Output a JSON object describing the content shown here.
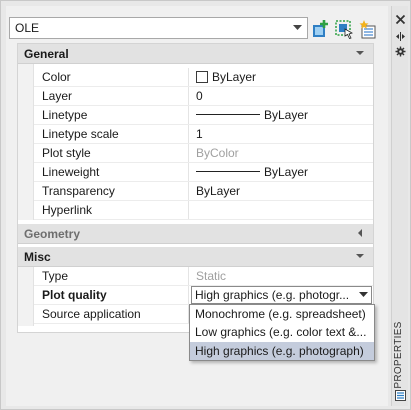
{
  "object_selector": {
    "value": "OLE"
  },
  "toolbar": [
    {
      "icon": "toggle-pickadd-icon",
      "tooltip": ""
    },
    {
      "icon": "select-objects-icon",
      "tooltip": ""
    },
    {
      "icon": "quick-select-icon",
      "tooltip": ""
    }
  ],
  "categories": {
    "general": {
      "label": "General",
      "rows": [
        {
          "name": "Color",
          "value": "ByLayer"
        },
        {
          "name": "Layer",
          "value": "0"
        },
        {
          "name": "Linetype",
          "value": "ByLayer"
        },
        {
          "name": "Linetype scale",
          "value": "1"
        },
        {
          "name": "Plot style",
          "value": "ByColor"
        },
        {
          "name": "Lineweight",
          "value": "ByLayer"
        },
        {
          "name": "Transparency",
          "value": "ByLayer"
        },
        {
          "name": "Hyperlink",
          "value": ""
        }
      ]
    },
    "geometry": {
      "label": "Geometry"
    },
    "misc": {
      "label": "Misc",
      "rows": [
        {
          "name": "Type",
          "value": "Static"
        },
        {
          "name": "Plot quality",
          "value": "High graphics (e.g. photogr..."
        },
        {
          "name": "Source application",
          "value": ""
        }
      ]
    }
  },
  "plot_quality_options": [
    "Monochrome (e.g. spreadsheet)",
    "Low graphics (e.g. color text &...",
    "High graphics (e.g. photograph)"
  ],
  "side_strip": {
    "label": "PROPERTIES"
  }
}
